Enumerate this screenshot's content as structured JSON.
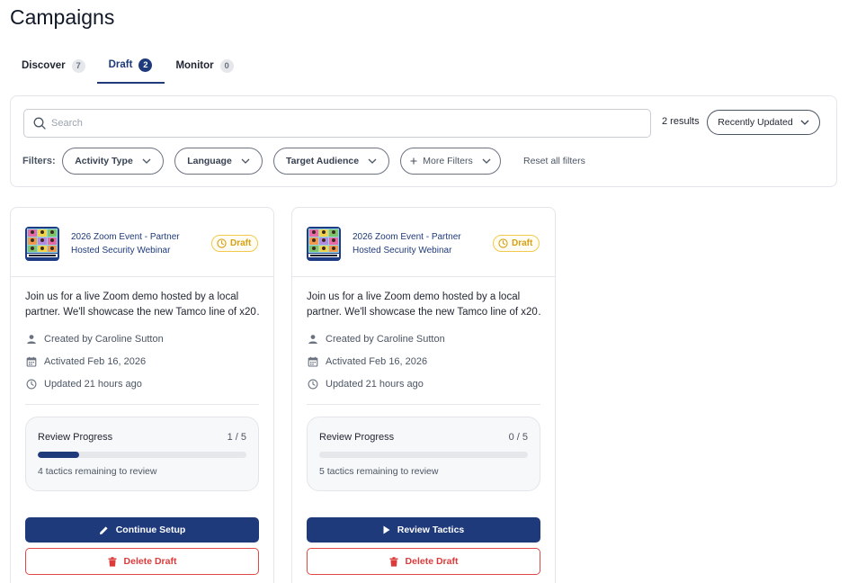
{
  "page": {
    "title": "Campaigns"
  },
  "tabs": [
    {
      "label": "Discover",
      "count": "7"
    },
    {
      "label": "Draft",
      "count": "2"
    },
    {
      "label": "Monitor",
      "count": "0"
    }
  ],
  "search": {
    "placeholder": "Search",
    "value": ""
  },
  "results": {
    "text": "2 results"
  },
  "sort": {
    "label": "Recently Updated"
  },
  "filters": {
    "label": "Filters:",
    "pills": [
      "Activity Type",
      "Language",
      "Target Audience"
    ],
    "more_label": "More Filters",
    "reset_label": "Reset all filters"
  },
  "cards": [
    {
      "title_line1": "2026 Zoom Event - Partner",
      "title_line2": "Hosted Security Webinar",
      "status": "Draft",
      "desc_line1": "Join us for a live Zoom demo hosted by a local",
      "desc_line2": "partner. We'll showcase the new Tamco line of x20…",
      "created": "Created by Caroline Sutton",
      "activated": "Activated Feb 16, 2026",
      "updated": "Updated 21 hours ago",
      "progress_label": "Review Progress",
      "progress_count": "1 / 5",
      "progress_fraction": 0.2,
      "progress_note": "4 tactics remaining to review",
      "primary_label": "Continue Setup",
      "primary_icon": "pencil-icon",
      "delete_label": "Delete Draft"
    },
    {
      "title_line1": "2026 Zoom Event - Partner",
      "title_line2": "Hosted Security Webinar",
      "status": "Draft",
      "desc_line1": "Join us for a live Zoom demo hosted by a local",
      "desc_line2": "partner. We'll showcase the new Tamco line of x20…",
      "created": "Created by Caroline Sutton",
      "activated": "Activated Feb 16, 2026",
      "updated": "Updated 21 hours ago",
      "progress_label": "Review Progress",
      "progress_count": "0 / 5",
      "progress_fraction": 0,
      "progress_note": "5 tactics remaining to review",
      "primary_label": "Review Tactics",
      "primary_icon": "play-icon",
      "delete_label": "Delete Draft"
    }
  ],
  "colors": {
    "brand": "#1e3a7b",
    "draft": "#d4a017",
    "danger": "#dc3b3b"
  }
}
